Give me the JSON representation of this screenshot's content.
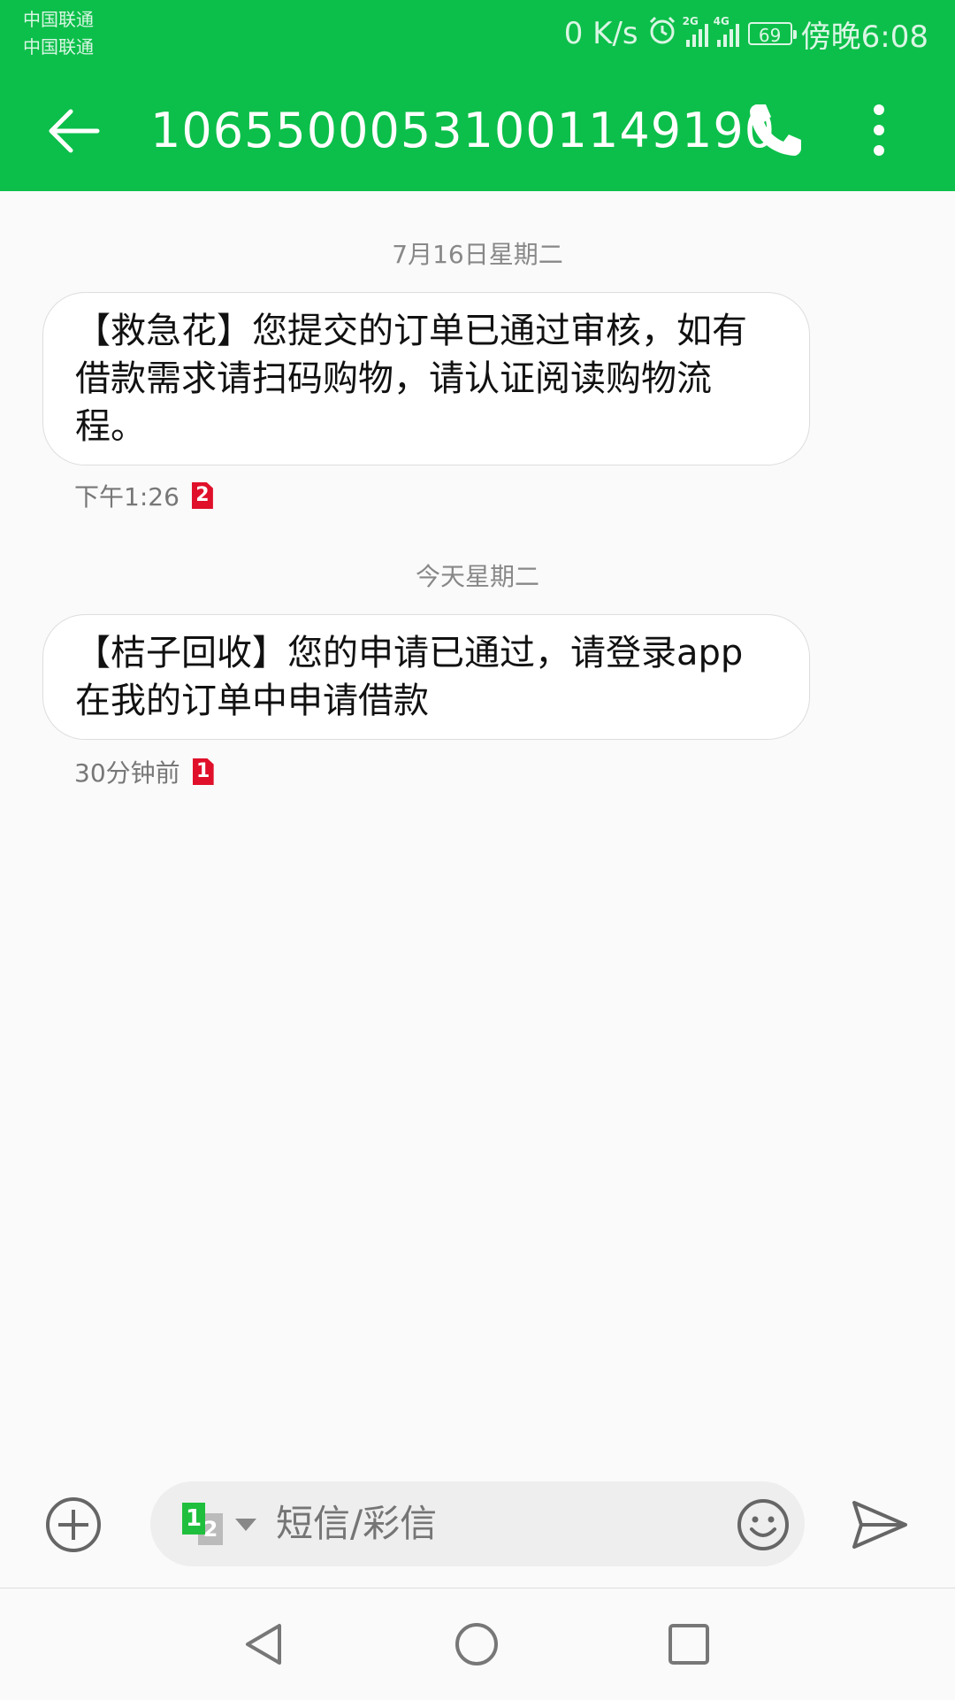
{
  "status_bar": {
    "carrier_1": "中国联通",
    "carrier_2": "中国联通",
    "net_speed": "0 K/s",
    "sim1_network": "2G",
    "sim2_network": "4G",
    "battery": "69",
    "time": "傍晚6:08"
  },
  "toolbar": {
    "title": "10655000531001149190"
  },
  "conversation": {
    "groups": [
      {
        "date": "7月16日星期二",
        "message": "【救急花】您提交的订单已通过审核，如有借款需求请扫码购物，请认证阅读购物流程。",
        "time": "下午1:26",
        "sim": "2"
      },
      {
        "date": "今天星期二",
        "message": "【桔子回收】您的申请已通过，请登录app在我的订单中申请借款",
        "time": "30分钟前",
        "sim": "1"
      }
    ]
  },
  "composer": {
    "sim_active": "1",
    "sim_other": "2",
    "placeholder": "短信/彩信"
  },
  "colors": {
    "accent": "#0cbf4a",
    "sim_badge": "#e0102a"
  }
}
